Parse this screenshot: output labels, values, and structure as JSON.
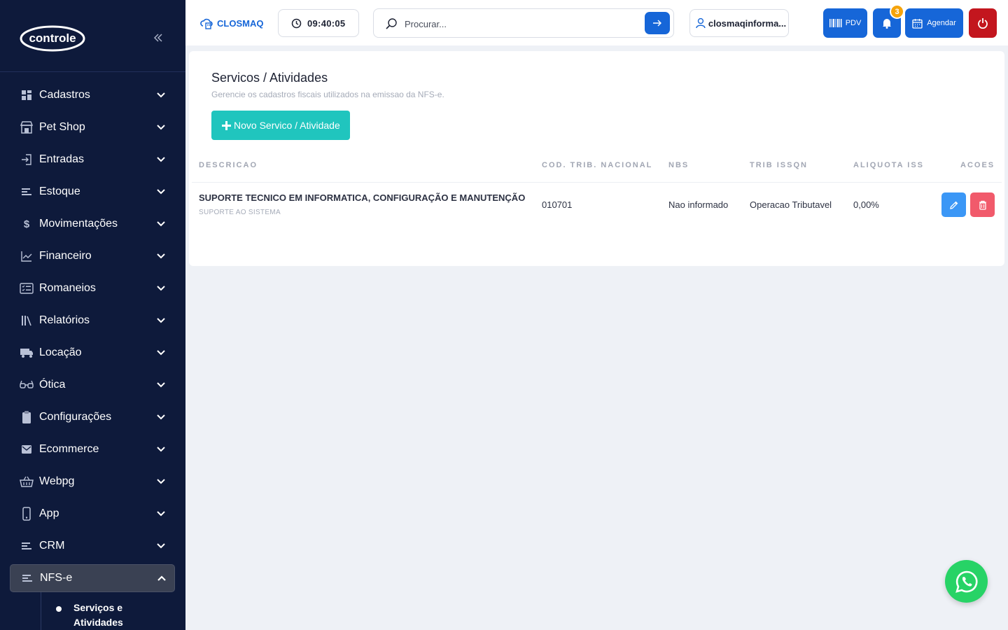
{
  "sidebar": {
    "logo_text": "controle",
    "items": [
      {
        "label": "Cadastros",
        "icon": "grid-icon"
      },
      {
        "label": "Pet Shop",
        "icon": "store-icon"
      },
      {
        "label": "Entradas",
        "icon": "enter-icon"
      },
      {
        "label": "Estoque",
        "icon": "list-icon"
      },
      {
        "label": "Movimentações",
        "icon": "dollar-icon"
      },
      {
        "label": "Financeiro",
        "icon": "chart-icon"
      },
      {
        "label": "Romaneios",
        "icon": "checklist-icon"
      },
      {
        "label": "Relatórios",
        "icon": "books-icon"
      },
      {
        "label": "Locação",
        "icon": "truck-icon"
      },
      {
        "label": "Ótica",
        "icon": "glasses-icon"
      },
      {
        "label": "Configurações",
        "icon": "clipboard-icon"
      },
      {
        "label": "Ecommerce",
        "icon": "mail-icon"
      },
      {
        "label": "Webpg",
        "icon": "basket-icon"
      },
      {
        "label": "App",
        "icon": "phone-icon"
      },
      {
        "label": "CRM",
        "icon": "list-icon"
      }
    ],
    "active_item": {
      "label": "NFS-e",
      "icon": "list-icon"
    },
    "subitem": {
      "label": "Serviços e Atividades"
    }
  },
  "topbar": {
    "brand": "CLOSMAQ",
    "clock": "09:40:05",
    "search_placeholder": "Procurar...",
    "user": "closmaqinforma...",
    "pdv_label": "PDV",
    "notifications_count": "3",
    "agendar_label": "Agendar"
  },
  "main": {
    "title": "Servicos / Atividades",
    "subtitle": "Gerencie os cadastros fiscais utilizados na emissao da NFS-e.",
    "new_button": "Novo Servico / Atividade",
    "columns": [
      "DESCRICAO",
      "COD. TRIB. NACIONAL",
      "NBS",
      "TRIB ISSQN",
      "ALIQUOTA ISS",
      "ACOES"
    ],
    "rows": [
      {
        "descricao": "SUPORTE TECNICO EM INFORMATICA, CONFIGURAÇÃO E MANUTENÇÃO",
        "descricao_sub": "SUPORTE AO SISTEMA",
        "cod": "010701",
        "nbs": "Nao informado",
        "trib": "Operacao Tributavel",
        "aliquota": "0,00%"
      }
    ]
  },
  "colors": {
    "sidebar_bg": "#0e1a3b",
    "primary": "#1666d8",
    "teal": "#20c5be",
    "danger": "#c3161e",
    "whatsapp": "#27d366"
  }
}
